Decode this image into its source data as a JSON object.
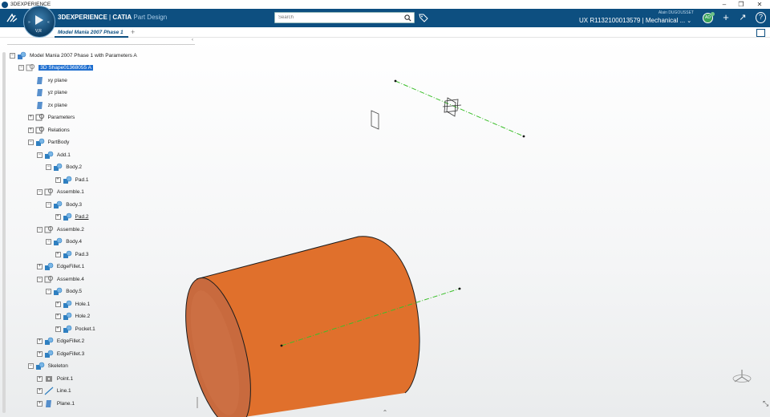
{
  "window": {
    "title": "3DEXPERIENCE",
    "controls": {
      "minimize": "–",
      "restore": "❐",
      "close": "✕"
    }
  },
  "topbar": {
    "brand_main": "3DEXPERIENCE",
    "brand_sep": " | ",
    "brand_catia": "CATIA",
    "brand_app": " Part Design",
    "compass_version": "V,R",
    "search": {
      "placeholder": "Search",
      "value": ""
    },
    "user_name": "Alain DUGOUSSET",
    "context_label": "UX R1132100013579 | Mechanical ...",
    "avatar_initials": "AD",
    "buttons": {
      "add": "+",
      "share": "↗",
      "help": "?"
    }
  },
  "tab": {
    "label": "Model Mania 2007 Phase 1",
    "close": "✕",
    "add": "+"
  },
  "tree": {
    "items": [
      {
        "label": "Model Mania 2007 Phase 1 with Parameters A",
        "level": 0,
        "icon": "product-icon",
        "expander": "−"
      },
      {
        "label": "3D Shape01368055 A",
        "level": 1,
        "icon": "3d-shape-icon",
        "expander": "−",
        "selected": true
      },
      {
        "label": "xy plane",
        "level": 2,
        "icon": "plane-icon",
        "expander": ""
      },
      {
        "label": "yz plane",
        "level": 2,
        "icon": "plane-icon",
        "expander": ""
      },
      {
        "label": "zx plane",
        "level": 2,
        "icon": "plane-icon",
        "expander": ""
      },
      {
        "label": "Parameters",
        "level": 2,
        "icon": "parameters-icon",
        "expander": "+"
      },
      {
        "label": "Relations",
        "level": 2,
        "icon": "relations-icon",
        "expander": "+"
      },
      {
        "label": "PartBody",
        "level": 2,
        "icon": "body-icon",
        "expander": "−"
      },
      {
        "label": "Add.1",
        "level": 3,
        "icon": "add-icon",
        "expander": "−"
      },
      {
        "label": "Body.2",
        "level": 4,
        "icon": "body-icon",
        "expander": "−"
      },
      {
        "label": "Pad.1",
        "level": 5,
        "icon": "pad-icon",
        "expander": "+"
      },
      {
        "label": "Assemble.1",
        "level": 3,
        "icon": "assemble-icon",
        "expander": "−"
      },
      {
        "label": "Body.3",
        "level": 4,
        "icon": "body-icon",
        "expander": "−"
      },
      {
        "label": "Pad.2",
        "level": 5,
        "icon": "pad-icon",
        "expander": "+",
        "underline": true
      },
      {
        "label": "Assemble.2",
        "level": 3,
        "icon": "assemble-icon",
        "expander": "−"
      },
      {
        "label": "Body.4",
        "level": 4,
        "icon": "body-icon",
        "expander": "−"
      },
      {
        "label": "Pad.3",
        "level": 5,
        "icon": "pad-icon",
        "expander": "+"
      },
      {
        "label": "EdgeFillet.1",
        "level": 3,
        "icon": "edge-fillet-icon",
        "expander": "+"
      },
      {
        "label": "Assemble.4",
        "level": 3,
        "icon": "assemble-icon",
        "expander": "−"
      },
      {
        "label": "Body.5",
        "level": 4,
        "icon": "body-icon",
        "expander": "−"
      },
      {
        "label": "Hole.1",
        "level": 5,
        "icon": "hole-icon",
        "expander": "+"
      },
      {
        "label": "Hole.2",
        "level": 5,
        "icon": "hole-icon",
        "expander": "+"
      },
      {
        "label": "Pocket.1",
        "level": 5,
        "icon": "pocket-icon",
        "expander": "+"
      },
      {
        "label": "EdgeFillet.2",
        "level": 3,
        "icon": "edge-fillet-icon",
        "expander": "+"
      },
      {
        "label": "EdgeFillet.3",
        "level": 3,
        "icon": "edge-fillet-icon",
        "expander": "+"
      },
      {
        "label": "Skeleton",
        "level": 2,
        "icon": "skeleton-icon",
        "expander": "−"
      },
      {
        "label": "Point.1",
        "level": 3,
        "icon": "point-icon",
        "expander": "+"
      },
      {
        "label": "Line.1",
        "level": 3,
        "icon": "line-icon",
        "expander": "+"
      },
      {
        "label": "Plane.1",
        "level": 3,
        "icon": "plane-icon",
        "expander": "+"
      }
    ]
  },
  "colors": {
    "topbar": "#0d4f80",
    "part_fill": "#e0702c",
    "part_dark": "#b8551b",
    "axis_line": "#3bbf2a",
    "selection": "#1f6fd0"
  }
}
